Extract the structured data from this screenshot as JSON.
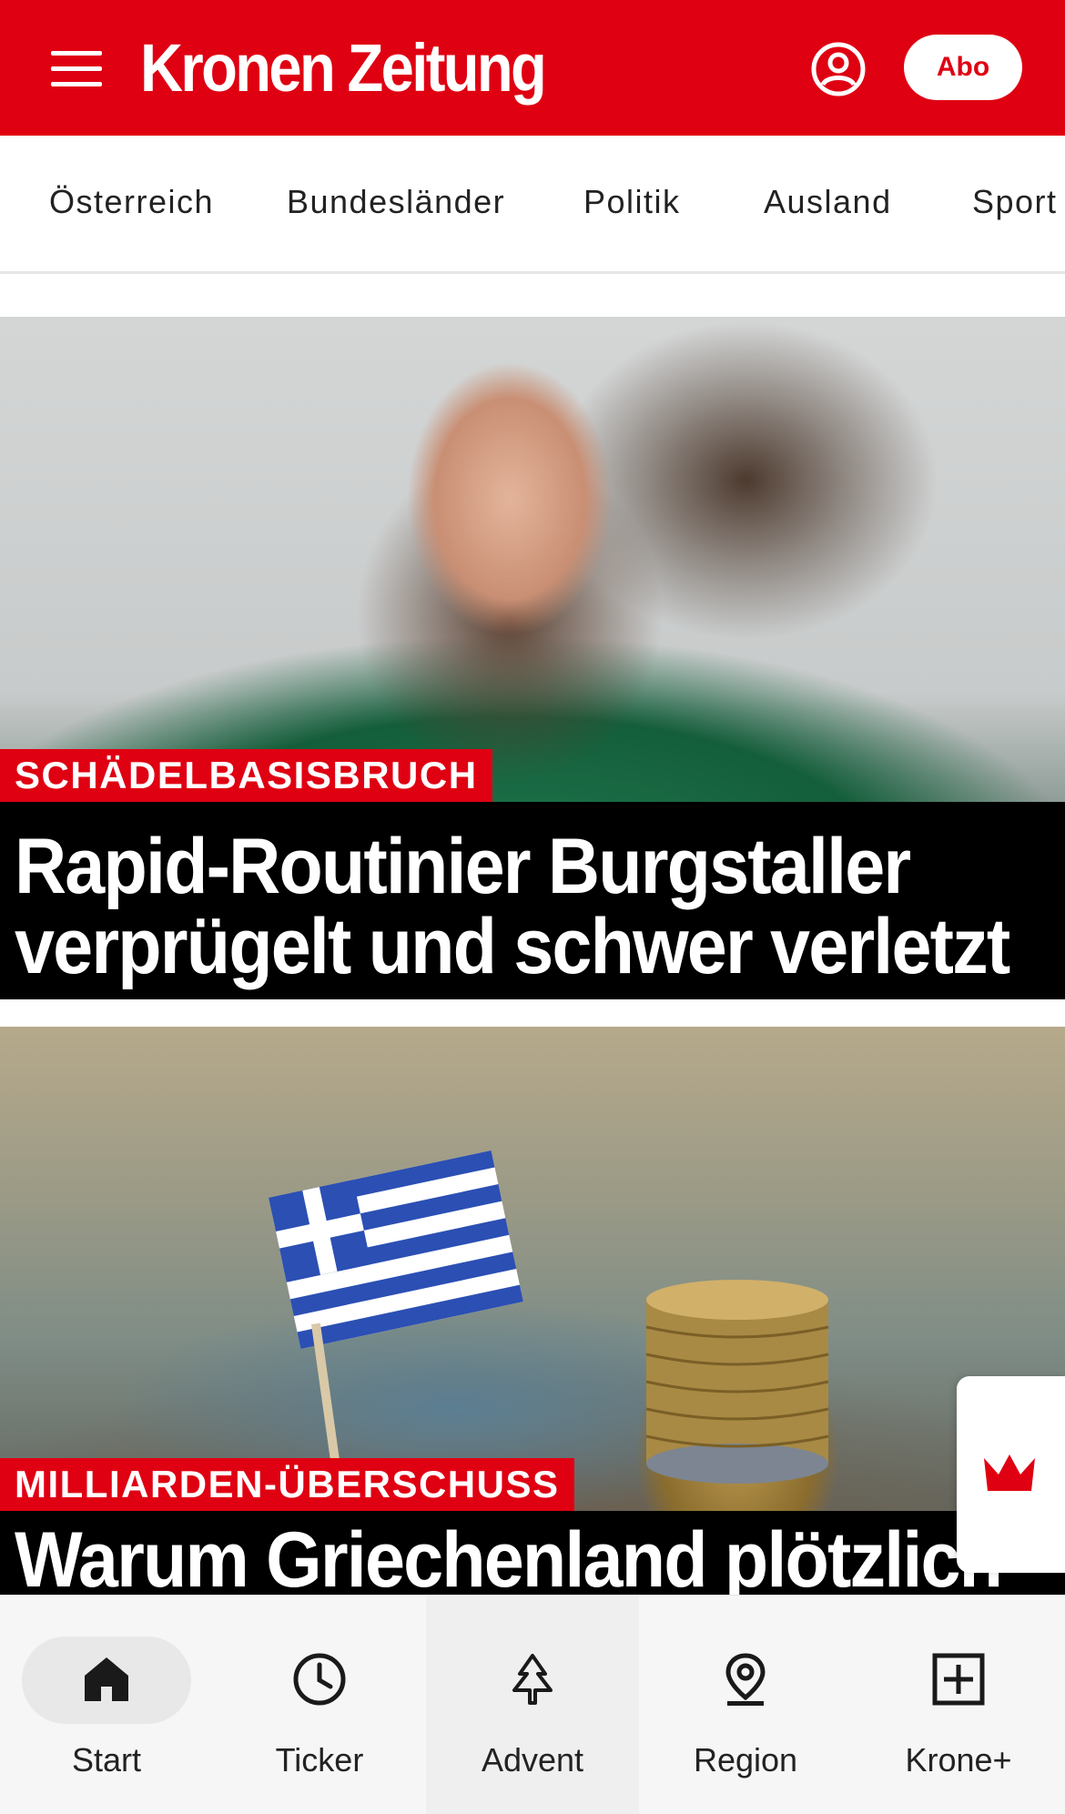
{
  "header": {
    "logo": "Kronen Zeitung",
    "abo_label": "Abo",
    "brand_color": "#df0012"
  },
  "categories": [
    "Österreich",
    "Bundesländer",
    "Politik",
    "Ausland",
    "Sport"
  ],
  "articles": [
    {
      "kicker": "SCHÄDELBASISBRUCH",
      "headline": "Rapid-Routinier Burgstaller verprügelt und schwer verletzt",
      "image": "football-player-photo"
    },
    {
      "kicker": "MILLIARDEN-ÜBERSCHUSS",
      "headline": "Warum Griechenland plötzlich",
      "image": "greek-flag-coins-photo"
    }
  ],
  "bottom_nav": [
    {
      "label": "Start",
      "icon": "home-icon",
      "active": true
    },
    {
      "label": "Ticker",
      "icon": "clock-icon"
    },
    {
      "label": "Advent",
      "icon": "tree-icon"
    },
    {
      "label": "Region",
      "icon": "location-pin-icon"
    },
    {
      "label": "Krone+",
      "icon": "plus-box-icon"
    }
  ],
  "floating_tab": {
    "icon": "krone-crown-icon"
  }
}
